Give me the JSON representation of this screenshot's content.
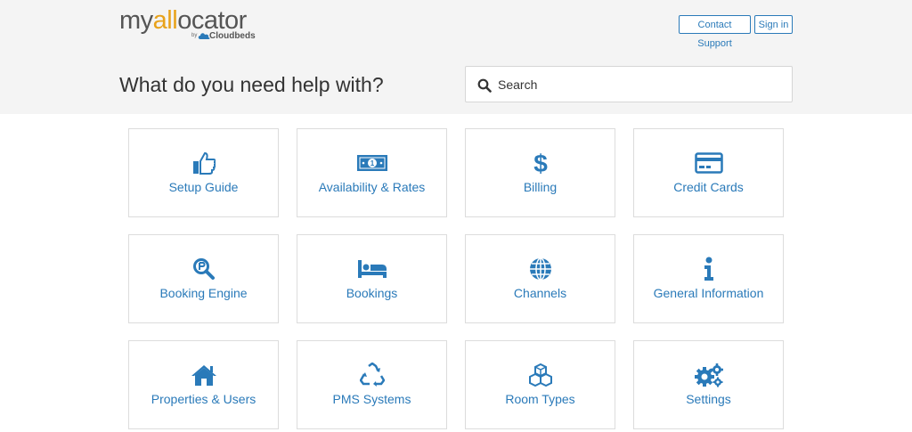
{
  "header": {
    "logo": {
      "my": "my",
      "all": "all",
      "rest": "ocator",
      "by": "by",
      "brand": "Cloudbeds"
    },
    "contact_support": "Contact Support",
    "sign_in": "Sign in",
    "title": "What do you need help with?",
    "search": {
      "placeholder": "Search",
      "value": ""
    }
  },
  "categories": [
    {
      "label": "Setup Guide",
      "icon": "thumbs-up-icon"
    },
    {
      "label": "Availability & Rates",
      "icon": "money-bill-icon"
    },
    {
      "label": "Billing",
      "icon": "dollar-icon"
    },
    {
      "label": "Credit Cards",
      "icon": "credit-card-icon"
    },
    {
      "label": "Booking Engine",
      "icon": "search-engine-icon"
    },
    {
      "label": "Bookings",
      "icon": "bed-icon"
    },
    {
      "label": "Channels",
      "icon": "globe-icon"
    },
    {
      "label": "General Information",
      "icon": "info-icon"
    },
    {
      "label": "Properties & Users",
      "icon": "home-icon"
    },
    {
      "label": "PMS Systems",
      "icon": "recycle-icon"
    },
    {
      "label": "Room Types",
      "icon": "cubes-icon"
    },
    {
      "label": "Settings",
      "icon": "gears-icon"
    }
  ],
  "colors": {
    "accent": "#2a7ab9",
    "header_bg": "#f4f4f4",
    "logo_orange": "#e8a21b"
  }
}
